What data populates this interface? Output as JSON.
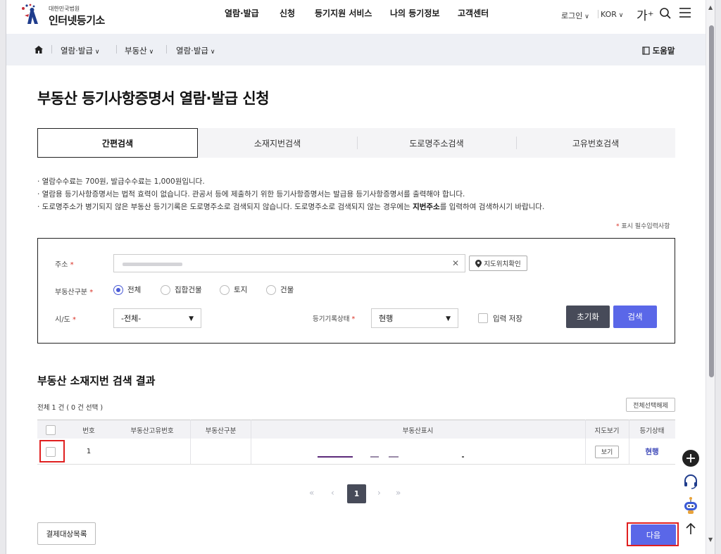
{
  "header": {
    "logo_small": "대한민국법원",
    "logo_title": "인터넷등기소",
    "nav": [
      "열람·발급",
      "신청",
      "등기지원 서비스",
      "나의 등기정보",
      "고객센터"
    ],
    "login": "로그인",
    "lang": "KOR",
    "font_size": "가⁺"
  },
  "breadcrumb": {
    "items": [
      "열람·발급",
      "부동산",
      "열람·발급"
    ],
    "help": "도움말"
  },
  "page": {
    "title": "부동산 등기사항증명서 열람·발급 신청"
  },
  "tabs": [
    "간편검색",
    "소재지번검색",
    "도로명주소검색",
    "고유번호검색"
  ],
  "notices": {
    "line1": "· 열람수수료는  700원, 발급수수료는  1,000원입니다.",
    "line2": "· 열람용 등기사항증명서는 법적 효력이 없습니다. 관공서 등에 제출하기 위한 등기사항증명서는 발급용 등기사항증명서를 출력해야 합니다.",
    "line3_pre": "· 도로명주소가 병기되지 않은 부동산 등기기록은 도로명주소로 검색되지 않습니다. 도로명주소로 검색되지 않는 경우에는 ",
    "line3_bold": "지번주소",
    "line3_post": "를 입력하여 검색하시기 바랍니다.",
    "required": "표시 필수입력사항"
  },
  "form": {
    "address_label": "주소",
    "map_button": "지도위치확인",
    "type_label": "부동산구분",
    "type_options": [
      "전체",
      "집합건물",
      "토지",
      "건물"
    ],
    "region_label": "시/도",
    "region_value": "-전체-",
    "status_label": "등기기록상태",
    "status_value": "현행",
    "save_label": "입력 저장",
    "reset": "초기화",
    "search": "검색"
  },
  "results": {
    "title": "부동산 소재지번 검색 결과",
    "count_text": "전체 1 건 ( 0 건 선택 )",
    "deselect_all": "전체선택해제",
    "columns": [
      "번호",
      "부동산고유번호",
      "부동산구분",
      "부동산표시",
      "지도보기",
      "등기상태"
    ],
    "rows": [
      {
        "no": "1",
        "view": "보기",
        "status": "현행"
      }
    ]
  },
  "pagination": {
    "first": "«",
    "prev": "‹",
    "current": "1",
    "next": "›",
    "last": "»"
  },
  "footer": {
    "cart": "결제대상목록",
    "next": "다음"
  },
  "colors": {
    "primary": "#5a67e8",
    "dark_button": "#474b59",
    "required": "#d93025",
    "highlight": "#e02020"
  }
}
